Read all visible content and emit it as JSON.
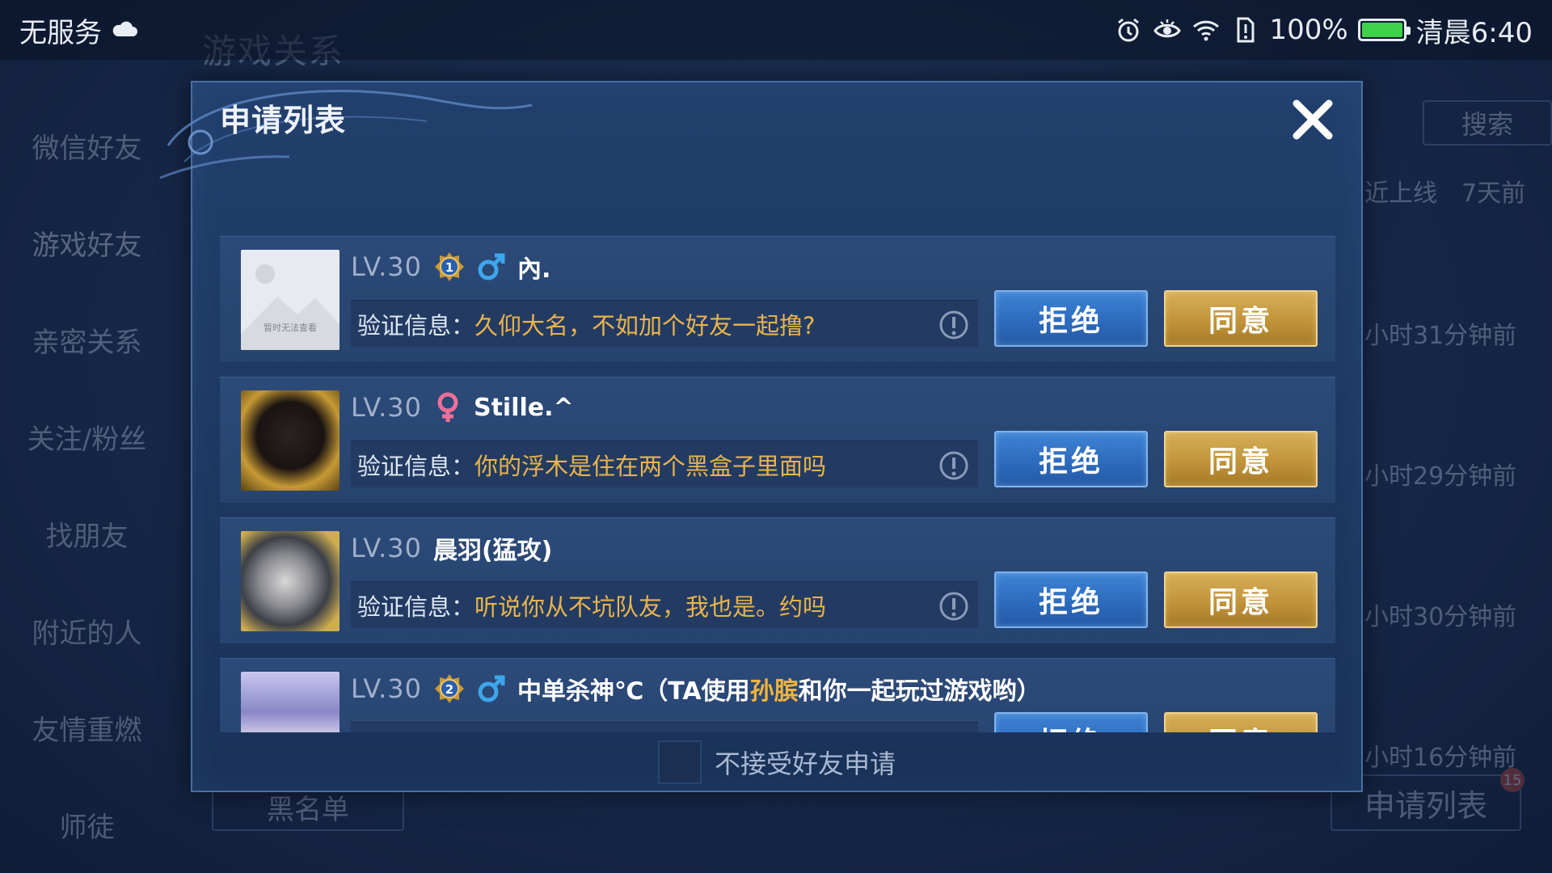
{
  "status_bar": {
    "carrier": "无服务",
    "battery": "100%",
    "time": "清晨6:40",
    "colors": {
      "battery_fill": "#3fd14a"
    }
  },
  "background": {
    "title": "游戏关系",
    "sidebar": [
      "微信好友",
      "游戏好友",
      "亲密关系",
      "关注/粉丝",
      "找朋友",
      "附近的人",
      "友情重燃",
      "师徒"
    ],
    "search_label": "搜索",
    "col_online": "近上线",
    "col_days": "7天前",
    "times": [
      "小时31分钟前",
      "小时29分钟前",
      "小时30分钟前",
      "小时16分钟前"
    ],
    "blacklist_label": "黑名单",
    "apply_list_label": "申请列表",
    "apply_badge": "15"
  },
  "dialog": {
    "title": "申请列表",
    "verify_label": "验证信息：",
    "reject_label": "拒绝",
    "accept_label": "同意",
    "footer_label": "不接受好友申请",
    "placeholder_avatar_text": "暂时无法查看",
    "requests": [
      {
        "level": "LV.30",
        "rank": "1",
        "gender": "male",
        "name": "內.",
        "message": "久仰大名，不如加个好友一起撸?"
      },
      {
        "level": "LV.30",
        "rank": "",
        "gender": "female",
        "name": "Stille.^",
        "message": "你的浮木是住在两个黑盒子里面吗"
      },
      {
        "level": "LV.30",
        "rank": "",
        "gender": "",
        "name": "晨羽(猛攻)",
        "message": "听说你从不坑队友，我也是。约吗"
      },
      {
        "level": "LV.30",
        "rank": "2",
        "gender": "male",
        "name_prefix": "中单杀神℃（TA使用",
        "name_hero": "孙膑",
        "name_suffix": "和你一起玩过游戏哟）"
      }
    ],
    "colors": {
      "message": "#e9b44c",
      "reject_bg": "#2d6bbd",
      "accept_bg": "#c1943a",
      "male": "#3ea6ec",
      "female": "#ee6f9a"
    }
  }
}
